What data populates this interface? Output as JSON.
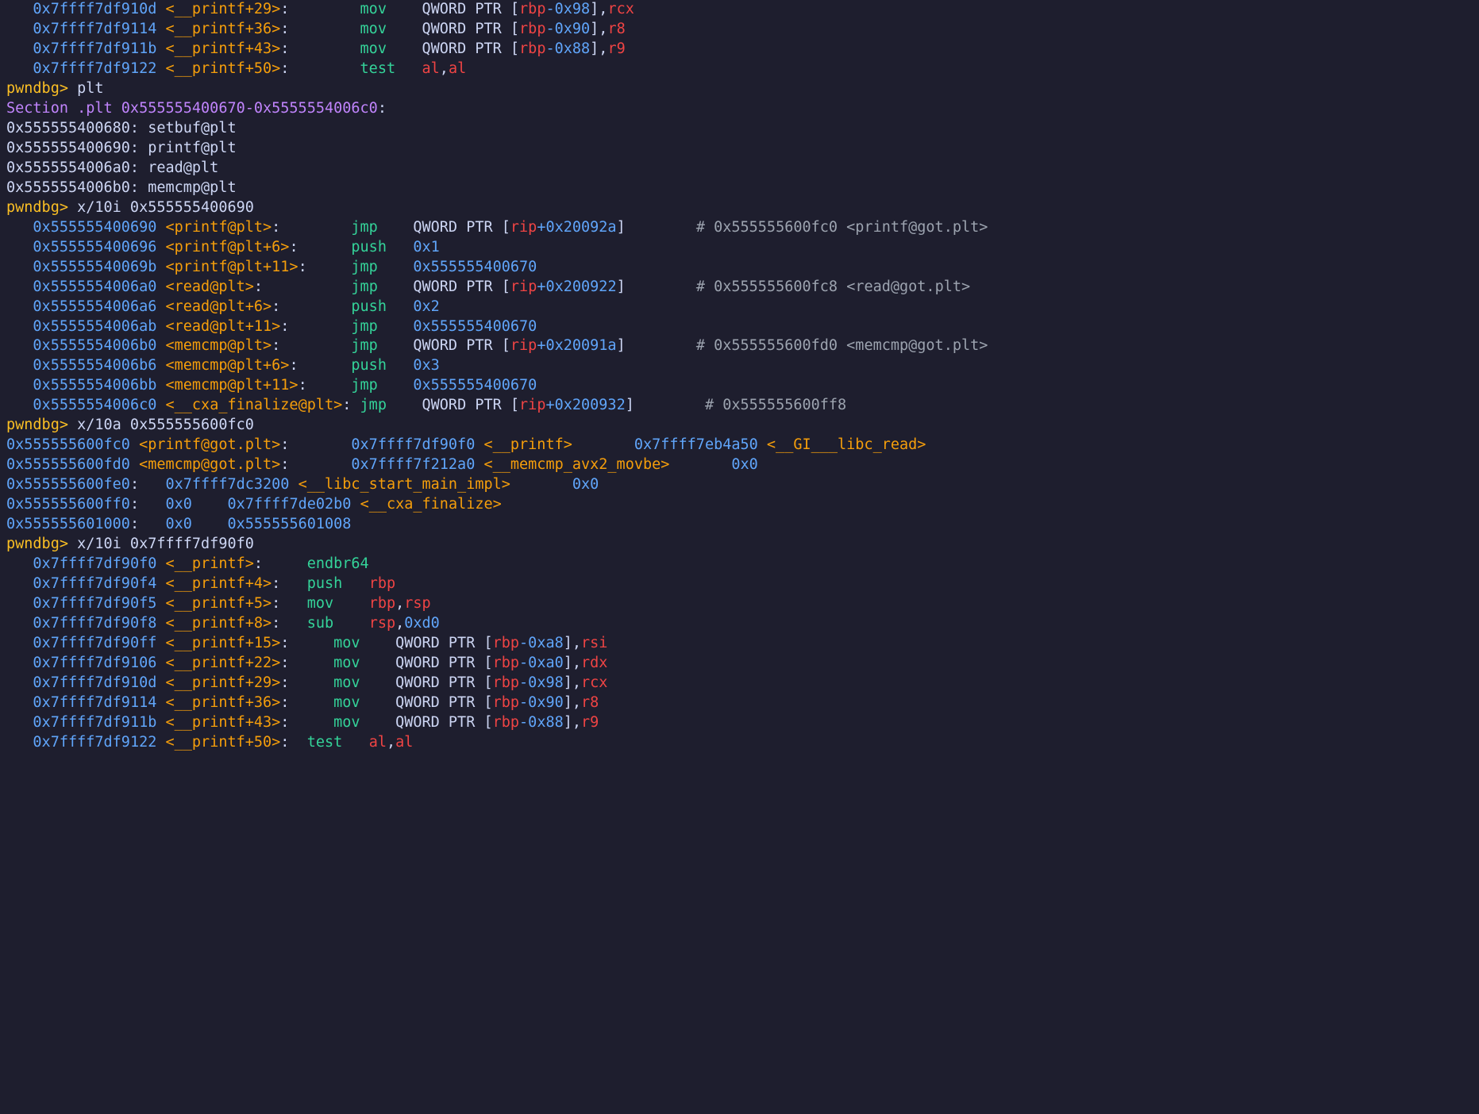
{
  "prompt": "pwndbg> ",
  "commands": {
    "c1": "plt",
    "c2": "x/10i 0x555555400690",
    "c3": "x/10a 0x555555600fc0",
    "c4": "x/10i 0x7ffff7df90f0"
  },
  "pltSection": {
    "label": "Section .plt ",
    "range": "0x555555400670-0x5555554006c0",
    "entries": [
      {
        "addr": "0x555555400680",
        "sym": "setbuf@plt"
      },
      {
        "addr": "0x555555400690",
        "sym": "printf@plt"
      },
      {
        "addr": "0x5555554006a0",
        "sym": "read@plt"
      },
      {
        "addr": "0x5555554006b0",
        "sym": "memcmp@plt"
      }
    ]
  },
  "top": [
    {
      "addr": "0x7ffff7df910d",
      "sym": "<__printf+29>",
      "op": "mov",
      "body": [
        "QWORD PTR ["
      ],
      "reg1": "rbp",
      "delta": "-0x98",
      "tail": "],",
      "reg2": "rcx"
    },
    {
      "addr": "0x7ffff7df9114",
      "sym": "<__printf+36>",
      "op": "mov",
      "body": [
        "QWORD PTR ["
      ],
      "reg1": "rbp",
      "delta": "-0x90",
      "tail": "],",
      "reg2": "r8"
    },
    {
      "addr": "0x7ffff7df911b",
      "sym": "<__printf+43>",
      "op": "mov",
      "body": [
        "QWORD PTR ["
      ],
      "reg1": "rbp",
      "delta": "-0x88",
      "tail": "],",
      "reg2": "r9"
    },
    {
      "addr": "0x7ffff7df9122",
      "sym": "<__printf+50>",
      "op": "test",
      "r1": "al",
      "r2": "al"
    }
  ],
  "disPlt": [
    {
      "addr": "0x555555400690",
      "sym": "<printf@plt>",
      "op": "jmp",
      "qp": true,
      "reg": "rip",
      "off": "+0x20092a",
      "cmt": "# 0x555555600fc0 <printf@got.plt>"
    },
    {
      "addr": "0x555555400696",
      "sym": "<printf@plt+6>",
      "op": "push",
      "imm": "0x1"
    },
    {
      "addr": "0x55555540069b",
      "sym": "<printf@plt+11>",
      "op": "jmp",
      "target": "0x555555400670"
    },
    {
      "addr": "0x5555554006a0",
      "sym": "<read@plt>",
      "op": "jmp",
      "qp": true,
      "reg": "rip",
      "off": "+0x200922",
      "cmt": "# 0x555555600fc8 <read@got.plt>"
    },
    {
      "addr": "0x5555554006a6",
      "sym": "<read@plt+6>",
      "op": "push",
      "imm": "0x2"
    },
    {
      "addr": "0x5555554006ab",
      "sym": "<read@plt+11>",
      "op": "jmp",
      "target": "0x555555400670"
    },
    {
      "addr": "0x5555554006b0",
      "sym": "<memcmp@plt>",
      "op": "jmp",
      "qp": true,
      "reg": "rip",
      "off": "+0x20091a",
      "cmt": "# 0x555555600fd0 <memcmp@got.plt>"
    },
    {
      "addr": "0x5555554006b6",
      "sym": "<memcmp@plt+6>",
      "op": "push",
      "imm": "0x3"
    },
    {
      "addr": "0x5555554006bb",
      "sym": "<memcmp@plt+11>",
      "op": "jmp",
      "target": "0x555555400670"
    },
    {
      "addr": "0x5555554006c0",
      "sym": "<__cxa_finalize@plt>",
      "op": "jmp",
      "qp": true,
      "reg": "rip",
      "off": "+0x200932",
      "cmt": "# 0x555555600ff8"
    }
  ],
  "got": [
    {
      "addr": "0x555555600fc0",
      "syma": "<printf@got.plt>",
      "v1": "0x7ffff7df90f0",
      "s1": "<__printf>",
      "v2": "0x7ffff7eb4a50",
      "s2": "<__GI___libc_read>"
    },
    {
      "addr": "0x555555600fd0",
      "syma": "<memcmp@got.plt>",
      "v1": "0x7ffff7f212a0",
      "s1": "<__memcmp_avx2_movbe>",
      "v2": "0x0",
      "s2": ""
    },
    {
      "addr": "0x555555600fe0",
      "syma": "",
      "v1": "0x7ffff7dc3200",
      "s1": "<__libc_start_main_impl>",
      "v2": "0x0",
      "s2": ""
    },
    {
      "addr": "0x555555600ff0",
      "syma": "",
      "v1": "0x0",
      "s1": "",
      "v2": "0x7ffff7de02b0",
      "s2": "<__cxa_finalize>"
    },
    {
      "addr": "0x555555601000",
      "syma": "",
      "v1": "0x0",
      "s1": "",
      "v2": "0x555555601008",
      "s2": ""
    }
  ],
  "disPrintf": [
    {
      "addr": "0x7ffff7df90f0",
      "sym": "<__printf>",
      "op": "endbr64"
    },
    {
      "addr": "0x7ffff7df90f4",
      "sym": "<__printf+4>",
      "op": "push",
      "r1": "rbp"
    },
    {
      "addr": "0x7ffff7df90f5",
      "sym": "<__printf+5>",
      "op": "mov",
      "r1": "rbp",
      "r2": "rsp"
    },
    {
      "addr": "0x7ffff7df90f8",
      "sym": "<__printf+8>",
      "op": "sub",
      "r1": "rsp",
      "imm": "0xd0"
    },
    {
      "addr": "0x7ffff7df90ff",
      "sym": "<__printf+15>",
      "op": "mov",
      "qp": true,
      "reg": "rbp",
      "off": "-0xa8",
      "r2": "rsi"
    },
    {
      "addr": "0x7ffff7df9106",
      "sym": "<__printf+22>",
      "op": "mov",
      "qp": true,
      "reg": "rbp",
      "off": "-0xa0",
      "r2": "rdx"
    },
    {
      "addr": "0x7ffff7df910d",
      "sym": "<__printf+29>",
      "op": "mov",
      "qp": true,
      "reg": "rbp",
      "off": "-0x98",
      "r2": "rcx"
    },
    {
      "addr": "0x7ffff7df9114",
      "sym": "<__printf+36>",
      "op": "mov",
      "qp": true,
      "reg": "rbp",
      "off": "-0x90",
      "r2": "r8"
    },
    {
      "addr": "0x7ffff7df911b",
      "sym": "<__printf+43>",
      "op": "mov",
      "qp": true,
      "reg": "rbp",
      "off": "-0x88",
      "r2": "r9"
    },
    {
      "addr": "0x7ffff7df9122",
      "sym": "<__printf+50>",
      "op": "test",
      "r1": "al",
      "r2": "al"
    }
  ]
}
